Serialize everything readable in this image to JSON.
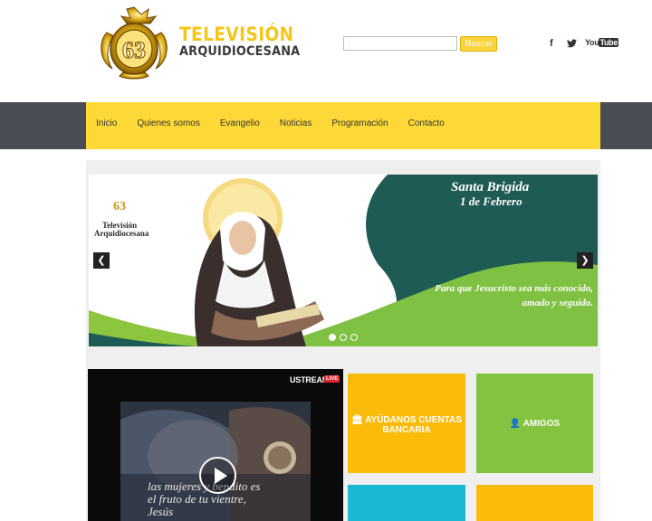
{
  "header": {
    "logo_number": "63",
    "logo_line1": "TELEVISIÓN",
    "logo_line2": "ARQUIDIOCESANA",
    "search_placeholder": "",
    "search_button": "Buscar",
    "social": {
      "facebook": "f",
      "youtube_you": "You",
      "youtube_tube": "Tube"
    }
  },
  "nav": {
    "items": [
      {
        "label": "Inicio"
      },
      {
        "label": "Quienes somos"
      },
      {
        "label": "Evangelio"
      },
      {
        "label": "Noticias"
      },
      {
        "label": "Programación"
      },
      {
        "label": "Contacto"
      }
    ]
  },
  "slider": {
    "heading_line1": "Santa Brigida",
    "heading_line2": "1 de Febrero",
    "caption": "Para que Jesucristo sea más conocido, amado y seguido.",
    "logo_number": "63",
    "logo_line1": "Televisión",
    "logo_line2": "Arquidiocesana",
    "dots": 3,
    "active_dot": 1
  },
  "video": {
    "brand": "USTREAM",
    "live_badge": "LIVE",
    "caption_line1": "las mujeres y bendito es",
    "caption_line2": "el fruto de tu vientre,",
    "caption_line3": "Jesús"
  },
  "tiles": {
    "donate_label_1": "AYÚDANOS CUENTAS",
    "donate_label_2": "BANCARIA",
    "friends_label": "AMIGOS"
  },
  "colors": {
    "brand_yellow": "#fcd936",
    "dark_band": "#4a4d53",
    "tile_yellow": "#fbbb0b",
    "tile_green": "#84c340",
    "tile_cyan": "#1ab8d3"
  }
}
